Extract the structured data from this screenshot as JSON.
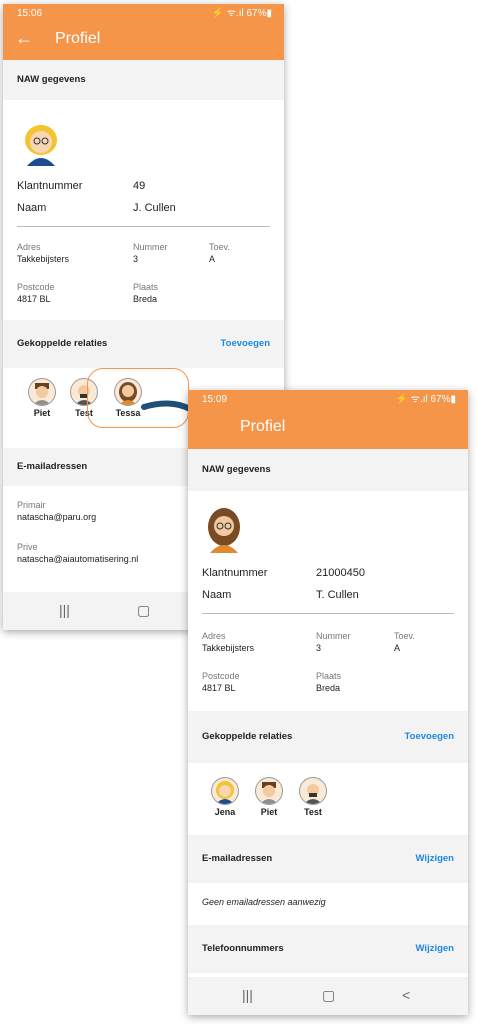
{
  "phone1": {
    "status_time": "15:06",
    "status_right": "⚡ ᯤ.ıl 67%▮",
    "title": "Profiel",
    "naw_header": "NAW gegevens",
    "klantnummer_label": "Klantnummer",
    "klantnummer_value": "49",
    "naam_label": "Naam",
    "naam_value": "J. Cullen",
    "adres_label": "Adres",
    "adres_value": "Takkebijsters",
    "nummer_label": "Nummer",
    "nummer_value": "3",
    "toev_label": "Toev.",
    "toev_value": "A",
    "postcode_label": "Postcode",
    "postcode_value": "4817 BL",
    "plaats_label": "Plaats",
    "plaats_value": "Breda",
    "relaties_header": "Gekoppelde relaties",
    "relaties_action": "Toevoegen",
    "relaties": [
      "Piet",
      "Test",
      "Tessa"
    ],
    "email_header": "E-mailadressen",
    "primair_label": "Primair",
    "primair_value": "natascha@paru.org",
    "prive_label": "Prive",
    "prive_value": "natascha@aiautomatisering.nl"
  },
  "phone2": {
    "status_time": "15:09",
    "status_right": "⚡ ᯤ.ıl 67%▮",
    "title": "Profiel",
    "naw_header": "NAW gegevens",
    "klantnummer_label": "Klantnummer",
    "klantnummer_value": "21000450",
    "naam_label": "Naam",
    "naam_value": "T. Cullen",
    "adres_label": "Adres",
    "adres_value": "Takkebijsters",
    "nummer_label": "Nummer",
    "nummer_value": "3",
    "toev_label": "Toev.",
    "toev_value": "A",
    "postcode_label": "Postcode",
    "postcode_value": "4817 BL",
    "plaats_label": "Plaats",
    "plaats_value": "Breda",
    "relaties_header": "Gekoppelde relaties",
    "relaties_action": "Toevoegen",
    "relaties": [
      "Jena",
      "Piet",
      "Test"
    ],
    "email_header": "E-mailadressen",
    "email_action": "Wijzigen",
    "email_empty": "Geen emailadressen aanwezig",
    "telefoon_header": "Telefoonnummers",
    "telefoon_action": "Wijzigen"
  },
  "navbar": {
    "recents": "|||",
    "home": "▢",
    "back": "<"
  },
  "colors": {
    "accent": "#f5954a",
    "link": "#1e88e5",
    "arrow": "#1f4e79"
  },
  "icons": [
    "back-arrow-icon",
    "avatar-icon",
    "curved-arrow-icon"
  ]
}
